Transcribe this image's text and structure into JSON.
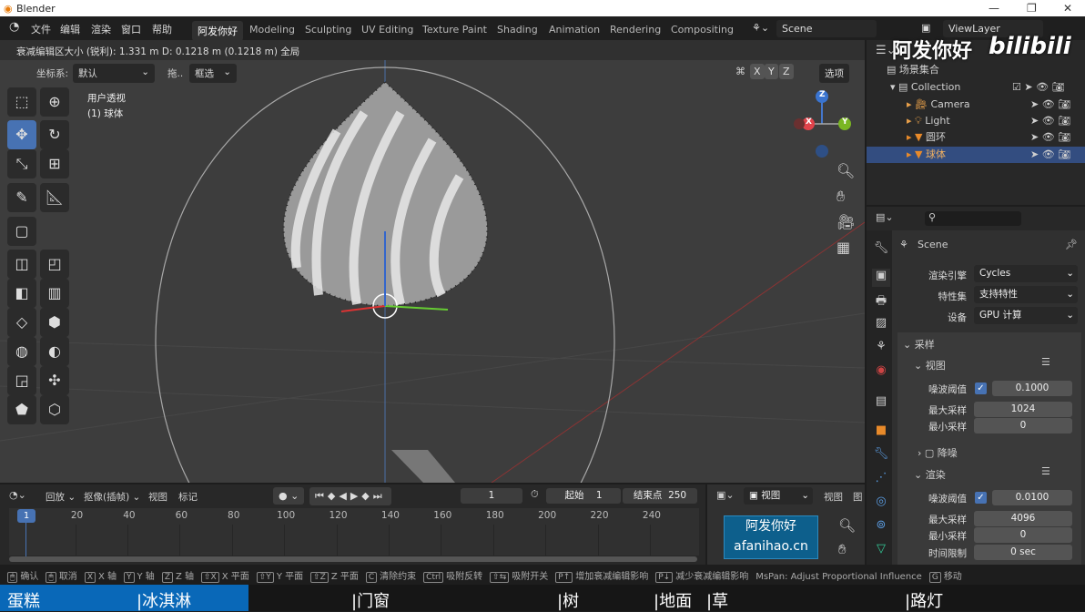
{
  "window": {
    "title": "Blender",
    "controls": [
      "—",
      "❐",
      "✕"
    ]
  },
  "menu": {
    "items": [
      "文件",
      "编辑",
      "渲染",
      "窗口",
      "帮助"
    ],
    "workspaces": [
      "阿发你好",
      "Modeling",
      "Sculpting",
      "UV Editing",
      "Texture Paint",
      "Shading",
      "Animation",
      "Rendering",
      "Compositing"
    ],
    "scene": "Scene",
    "view_layer": "ViewLayer"
  },
  "viewport": {
    "status": "衰减编辑区大小 (锐利): 1.331 m   D: 0.1218 m (0.1218 m) 全局",
    "coord_label": "坐标系:",
    "coord_value": "默认",
    "drag_label": "拖..",
    "drag_value": "框选",
    "view_name": "用户透视",
    "object_name": "(1) 球体",
    "axes": [
      "X",
      "Y",
      "Z"
    ],
    "options": "选项",
    "gizmo": {
      "x": "X",
      "y": "Y",
      "z": "Z"
    }
  },
  "outliner": {
    "root": "场景集合",
    "collection": "Collection",
    "items": [
      {
        "name": "Camera",
        "color": "#e8a04a"
      },
      {
        "name": "Light",
        "color": "#e8a04a"
      },
      {
        "name": "圆环",
        "color": "#e88a2a"
      },
      {
        "name": "球体",
        "color": "#e88a2a",
        "selected": true
      }
    ]
  },
  "watermark": {
    "text": "阿发你好",
    "brand": "bilibili",
    "site_line1": "阿发你好",
    "site_line2": "afanihao.cn"
  },
  "properties": {
    "title": "Scene",
    "engine_label": "渲染引擎",
    "engine": "Cycles",
    "feature_label": "特性集",
    "feature": "支持特性",
    "device_label": "设备",
    "device": "GPU 计算",
    "sampling": "采样",
    "viewport": "视图",
    "render": "渲染",
    "denoise": "降噪",
    "v_noise_label": "噪波阈值",
    "v_noise": "0.1000",
    "v_max_label": "最大采样",
    "v_max": "1024",
    "v_min_label": "最小采样",
    "v_min": "0",
    "r_noise_label": "噪波阈值",
    "r_noise": "0.0100",
    "r_max_label": "最大采样",
    "r_max": "4096",
    "r_min_label": "最小采样",
    "r_min": "0",
    "r_time_label": "时间限制",
    "r_time": "0 sec"
  },
  "timeline": {
    "menus": [
      "回放",
      "抠像(插帧)",
      "视图",
      "标记"
    ],
    "current": "1",
    "start_label": "起始",
    "start": "1",
    "end_label": "结束点",
    "end": "250",
    "ticks": [
      "20",
      "40",
      "60",
      "80",
      "100",
      "120",
      "140",
      "160",
      "180",
      "200",
      "220",
      "240"
    ]
  },
  "image_editor": {
    "view": "视图",
    "menus": [
      "视图",
      "图"
    ]
  },
  "statusbar": [
    {
      "k": "🖱",
      "t": "确认"
    },
    {
      "k": "🖱",
      "t": "取消"
    },
    {
      "k": "X",
      "t": "X 轴"
    },
    {
      "k": "Y",
      "t": "Y 轴"
    },
    {
      "k": "Z",
      "t": "Z 轴"
    },
    {
      "k": "⇧X",
      "t": "X 平面"
    },
    {
      "k": "⇧Y",
      "t": "Y 平面"
    },
    {
      "k": "⇧Z",
      "t": "Z 平面"
    },
    {
      "k": "C",
      "t": "清除约束"
    },
    {
      "k": "Ctrl",
      "t": "吸附反转"
    },
    {
      "k": "⇧⇆",
      "t": "吸附开关"
    },
    {
      "k": "P↑",
      "t": "增加衰减编辑影响"
    },
    {
      "k": "P↓",
      "t": "减少衰减编辑影响"
    },
    {
      "k": "",
      "t": "MsPan: Adjust Proportional Influence"
    },
    {
      "k": "G",
      "t": "移动"
    }
  ],
  "subtitles": [
    "蛋糕",
    "冰淇淋",
    "门窗",
    "树",
    "地面",
    "草",
    "路灯"
  ]
}
